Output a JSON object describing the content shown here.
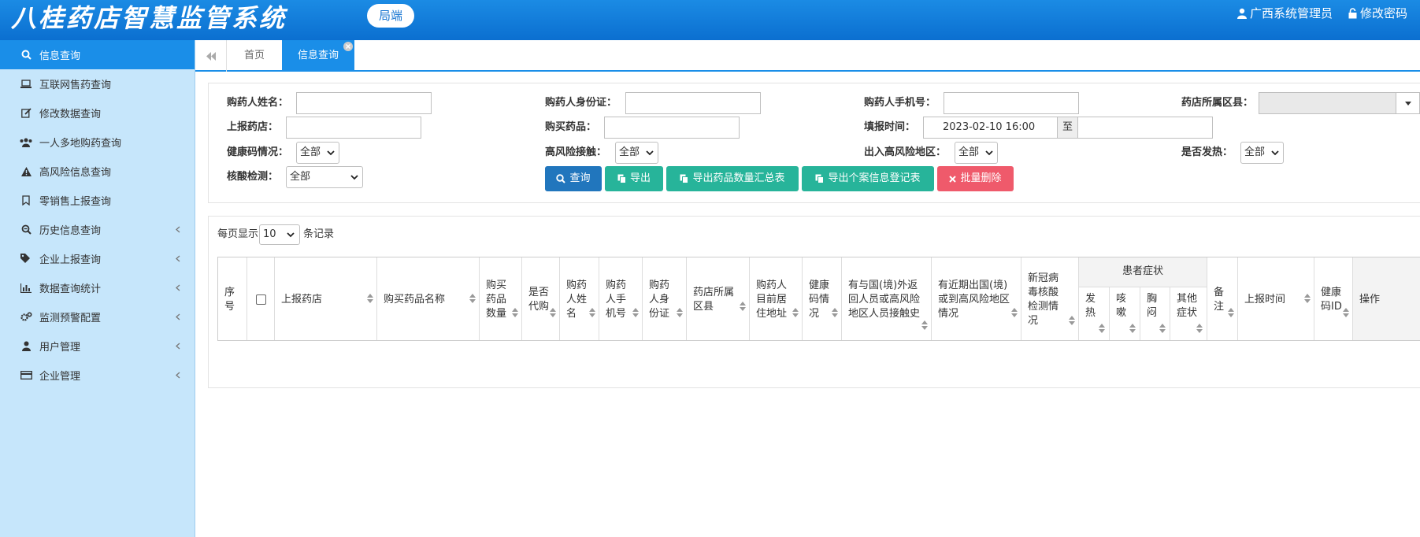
{
  "header": {
    "logo": "八桂药店智慧监管系统",
    "badge": "局端",
    "user": "广西系统管理员",
    "change_password": "修改密码"
  },
  "sidebar": {
    "items": [
      {
        "label": "信息查询",
        "icon": "search-icon"
      },
      {
        "label": "互联网售药查询",
        "icon": "laptop-icon"
      },
      {
        "label": "修改数据查询",
        "icon": "edit-icon"
      },
      {
        "label": "一人多地购药查询",
        "icon": "users-icon"
      },
      {
        "label": "高风险信息查询",
        "icon": "warning-icon"
      },
      {
        "label": "零销售上报查询",
        "icon": "bookmark-icon"
      },
      {
        "label": "历史信息查询",
        "icon": "search-minus-icon"
      },
      {
        "label": "企业上报查询",
        "icon": "tags-icon"
      },
      {
        "label": "数据查询统计",
        "icon": "bar-chart-icon"
      },
      {
        "label": "监测预警配置",
        "icon": "cogs-icon"
      },
      {
        "label": "用户管理",
        "icon": "user-icon"
      },
      {
        "label": "企业管理",
        "icon": "credit-card-icon"
      }
    ]
  },
  "tabs": {
    "home": "首页",
    "active": "信息查询"
  },
  "filters": {
    "buyer_name": "购药人姓名：",
    "buyer_id": "购药人身份证：",
    "buyer_phone": "购药人手机号：",
    "district": "药店所属区县：",
    "report_store": "上报药店：",
    "drug": "购买药品：",
    "fill_time": "填报时间：",
    "fill_time_start": "2023-02-10  16:00",
    "fill_time_to": "至",
    "health_code": "健康码情况：",
    "high_risk_contact": "高风险接触：",
    "high_risk_area": "出入高风险地区：",
    "fever": "是否发热：",
    "nucleic": "核酸检测：",
    "all": "全部"
  },
  "buttons": {
    "query": "查询",
    "export": "导出",
    "export_summary": "导出药品数量汇总表",
    "export_case": "导出个案信息登记表",
    "batch_delete": "批量删除"
  },
  "colors": {
    "primary": "#1a8ee8",
    "query": "#2176bd",
    "export": "#27b49a",
    "delete": "#ef5a6b",
    "sidebar_bg": "#c6e6fb"
  },
  "pager": {
    "prefix": "每页显示",
    "size": "10",
    "suffix": "条记录"
  },
  "table": {
    "col_seq": "序\n号",
    "col_store": "上报药店",
    "col_drug_name": "购买药品名称",
    "col_qty": "购买\n药品\n数量",
    "col_proxy": "是否\n代购",
    "col_buyer_name": "购药\n人姓\n名",
    "col_buyer_phone": "购药\n人手\n机号",
    "col_buyer_id": "购药\n人身\n份证",
    "col_district": "药店所属\n区县",
    "col_address": "购药人\n目前居\n住地址",
    "col_health": "健康\n码情\n况",
    "col_contact": "有与国(境)外返\n回人员或高风险\n地区人员接触史",
    "col_travel": "有近期出国(境)\n或到高风险地区\n情况",
    "col_nucleic": "新冠病\n毒核酸\n检测情\n况",
    "symptoms_group": "患者症状",
    "sym_fever": "发\n热",
    "sym_cough": "咳\n嗽",
    "sym_chest": "胸\n闷",
    "sym_other": "其他\n症状",
    "col_remark": "备\n注",
    "col_report_time": "上报时间",
    "col_health_id": "健康\n码ID",
    "col_op": "操作"
  }
}
